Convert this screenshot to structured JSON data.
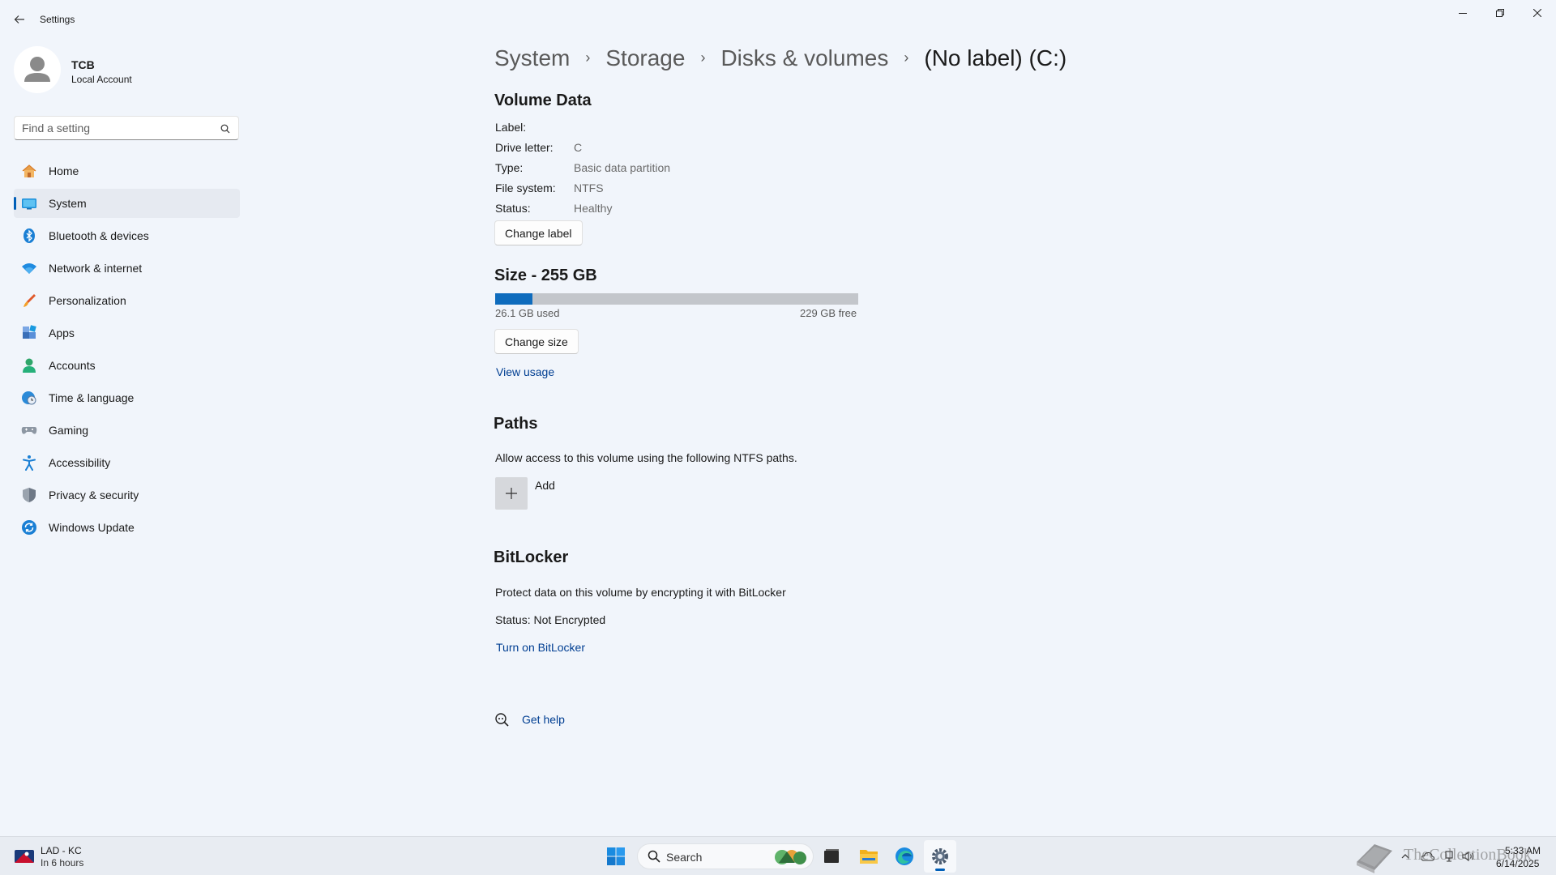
{
  "window": {
    "app_title": "Settings",
    "controls": [
      "minimize",
      "restore",
      "close"
    ]
  },
  "profile": {
    "name": "TCB",
    "account_type": "Local Account"
  },
  "search": {
    "placeholder": "Find a setting"
  },
  "sidebar": {
    "items": [
      {
        "label": "Home",
        "icon": "home-icon",
        "active": false
      },
      {
        "label": "System",
        "icon": "system-icon",
        "active": true
      },
      {
        "label": "Bluetooth & devices",
        "icon": "bluetooth-icon",
        "active": false
      },
      {
        "label": "Network & internet",
        "icon": "wifi-icon",
        "active": false
      },
      {
        "label": "Personalization",
        "icon": "brush-icon",
        "active": false
      },
      {
        "label": "Apps",
        "icon": "apps-icon",
        "active": false
      },
      {
        "label": "Accounts",
        "icon": "accounts-icon",
        "active": false
      },
      {
        "label": "Time & language",
        "icon": "globe-clock-icon",
        "active": false
      },
      {
        "label": "Gaming",
        "icon": "gamepad-icon",
        "active": false
      },
      {
        "label": "Accessibility",
        "icon": "accessibility-icon",
        "active": false
      },
      {
        "label": "Privacy & security",
        "icon": "shield-icon",
        "active": false
      },
      {
        "label": "Windows Update",
        "icon": "update-icon",
        "active": false
      }
    ]
  },
  "breadcrumb": [
    "System",
    "Storage",
    "Disks & volumes",
    "(No label) (C:)"
  ],
  "volume_data": {
    "heading": "Volume Data",
    "fields": [
      {
        "label": "Label:",
        "value": ""
      },
      {
        "label": "Drive letter:",
        "value": "C"
      },
      {
        "label": "Type:",
        "value": "Basic data partition"
      },
      {
        "label": "File system:",
        "value": "NTFS"
      },
      {
        "label": "Status:",
        "value": "Healthy"
      }
    ],
    "change_label_button": "Change label"
  },
  "size": {
    "heading": "Size - 255 GB",
    "used_label": "26.1 GB used",
    "free_label": "229 GB free",
    "used_fraction": 0.102,
    "change_size_button": "Change size",
    "view_usage_link": "View usage"
  },
  "paths": {
    "heading": "Paths",
    "description": "Allow access to this volume using the following NTFS paths.",
    "add_label": "Add"
  },
  "bitlocker": {
    "heading": "BitLocker",
    "description": "Protect data on this volume by encrypting it with BitLocker",
    "status": "Status: Not Encrypted",
    "turn_on_link": "Turn on BitLocker"
  },
  "help": {
    "get_help_link": "Get help"
  },
  "taskbar": {
    "widget_title": "LAD - KC",
    "widget_subtitle": "In 6 hours",
    "search_label": "Search",
    "time": "5:33 AM",
    "date": "6/14/2025"
  },
  "watermark": "TheCollectionBook",
  "colors": {
    "accent": "#005fb8",
    "bar_used": "#0f6cbd",
    "bar_free": "#c3c6cb",
    "link": "#003e92",
    "background": "#f1f5fb"
  }
}
